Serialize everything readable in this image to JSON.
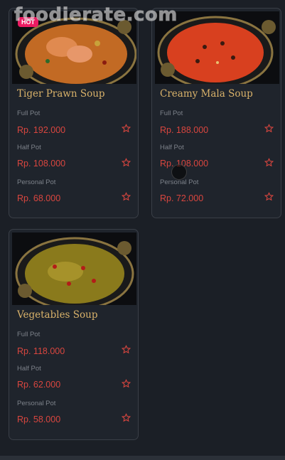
{
  "watermark": "foodierate.com",
  "badge": "HOT",
  "size_labels": {
    "full": "Full Pot",
    "half": "Half Pot",
    "personal": "Personal Pot"
  },
  "cards": [
    {
      "title": "Tiger Prawn Soup",
      "prices": {
        "full": "Rp. 192.000",
        "half": "Rp. 108.000",
        "personal": "Rp. 68.000"
      },
      "soup_color": "#c26a24",
      "has_badge": true
    },
    {
      "title": "Creamy Mala Soup",
      "prices": {
        "full": "Rp. 188.000",
        "half": "Rp. 108.000",
        "personal": "Rp. 72.000"
      },
      "soup_color": "#d8401f",
      "has_badge": false
    },
    {
      "title": "Vegetables Soup",
      "prices": {
        "full": "Rp. 118.000",
        "half": "Rp. 62.000",
        "personal": "Rp. 58.000"
      },
      "soup_color": "#8a7a1c",
      "has_badge": false
    }
  ],
  "colors": {
    "background": "#1b1f26",
    "card_border": "#3a3f47",
    "title": "#d9b26a",
    "price": "#d9463f",
    "label": "#7d828a",
    "badge": "#ec1b62"
  },
  "icons": {
    "favorite": "star-outline-icon"
  }
}
